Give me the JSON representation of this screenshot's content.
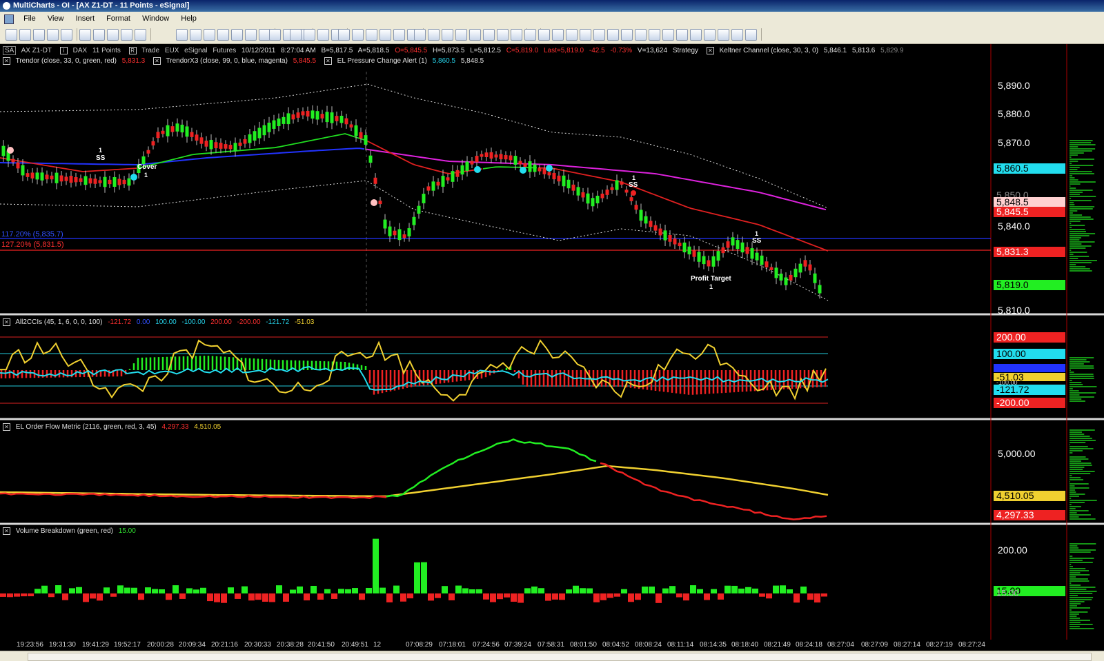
{
  "window": {
    "title": "MultiCharts - OI - [AX Z1-DT - 11 Points - eSignal]"
  },
  "menu": [
    "File",
    "View",
    "Insert",
    "Format",
    "Window",
    "Help"
  ],
  "status": {
    "symbol_box": "SA",
    "symbol": "AX Z1-DT",
    "name": "DAX",
    "resolution": "11 Points",
    "mode": "Trade",
    "exchange": "EUX",
    "feed": "eSignal",
    "category": "Futures",
    "date": "10/12/2011",
    "time": "8:27:04 AM",
    "bid": "B=5,817.5",
    "ask": "A=5,818.5",
    "open": "O=5,845.5",
    "high": "H=5,873.5",
    "low": "L=5,812.5",
    "close": "C=5,819.0",
    "last": "Last=5,819.0",
    "change": "-42.5",
    "change_pct": "-0.73%",
    "volume": "V=13,624",
    "strategy": "Strategy",
    "keltner": "Keltner Channel  (close,  30,  3,  0)",
    "keltner_v1": "5,846.1",
    "keltner_v2": "5,813.6",
    "keltner_v3": "5,829.9"
  },
  "indicators_line2": {
    "trendor": "Trendor  (close,  33,  0,  green,  red)",
    "trendor_val": "5,831.3",
    "trendorx3": "TrendorX3  (close,  99,  0,  blue,  magenta)",
    "trendorx3_val": "5,845.5",
    "el_pressure": "EL Pressure Change Alert  (1)",
    "el_pressure_v1": "5,860.5",
    "el_pressure_v2": "5,848.5"
  },
  "fib_labels": {
    "fib1": "117.20% (5,835.7)",
    "fib2": "127.20% (5,831.5)"
  },
  "markers": {
    "ss1_num": "1",
    "ss1_text": "SS",
    "cover_text": "Cover",
    "cover_num": "1",
    "ss2_num": "1",
    "ss2_text": "SS",
    "ss3_num": "1",
    "ss3_text": "SS",
    "pt_text": "Profit Target",
    "pt_num": "1"
  },
  "price_axis": [
    "5,890.0",
    "5,880.0",
    "5,870.0",
    "5,840.0",
    "5,810.0"
  ],
  "price_tags": {
    "t1": "5,860.5",
    "t2": "5,848.5",
    "t3": "5,845.5",
    "t4": "5,831.3",
    "t5": "5,819.0",
    "t6": "5,850.0"
  },
  "cci": {
    "header": "All2CCIs  (45,  1,  6,  0,  0,  100)",
    "v1": "-121.72",
    "v2": "0.00",
    "v3": "100.00",
    "v4": "-100.00",
    "v5": "200.00",
    "v6": "-200.00",
    "v7": "-121.72",
    "v8": "-51.03",
    "tags": {
      "p200": "200.00",
      "p100": "100.00",
      "zero": "0.00",
      "m51": "-51.03",
      "m100": "-100.00",
      "m121": "-121.72",
      "m200": "-200.00"
    }
  },
  "order_flow": {
    "header": "EL Order Flow Metric  (2116,  green,  red,  3,  45)",
    "v1": "4,297.33",
    "v2": "4,510.05",
    "axis": "5,000.00",
    "tags": {
      "yellow": "4,510.05",
      "red": "4,297.33"
    }
  },
  "volume": {
    "header": "Volume Breakdown  (green,  red)",
    "v1": "15.00",
    "axis": "200.00",
    "tags": {
      "green": "15.00",
      "under": "15.00"
    }
  },
  "time_axis": [
    "19:23:56",
    "19:31:30",
    "19:41:29",
    "19:52:17",
    "20:00:28",
    "20:09:34",
    "20:21:16",
    "20:30:33",
    "20:38:28",
    "20:41:50",
    "20:49:51",
    "12",
    "07:08:29",
    "07:18:01",
    "07:24:56",
    "07:39:24",
    "07:58:31",
    "08:01:50",
    "08:04:52",
    "08:08:24",
    "08:11:14",
    "08:14:35",
    "08:18:40",
    "08:21:49",
    "08:24:18",
    "08:27:04",
    "08:27:09",
    "08:27:14",
    "08:27:19",
    "08:27:24"
  ],
  "colors": {
    "up": "#22ee22",
    "down": "#ee2222",
    "cyan": "#22ddee",
    "yellow": "#f0d030",
    "magenta": "#dd22dd",
    "blue": "#2233ff"
  }
}
